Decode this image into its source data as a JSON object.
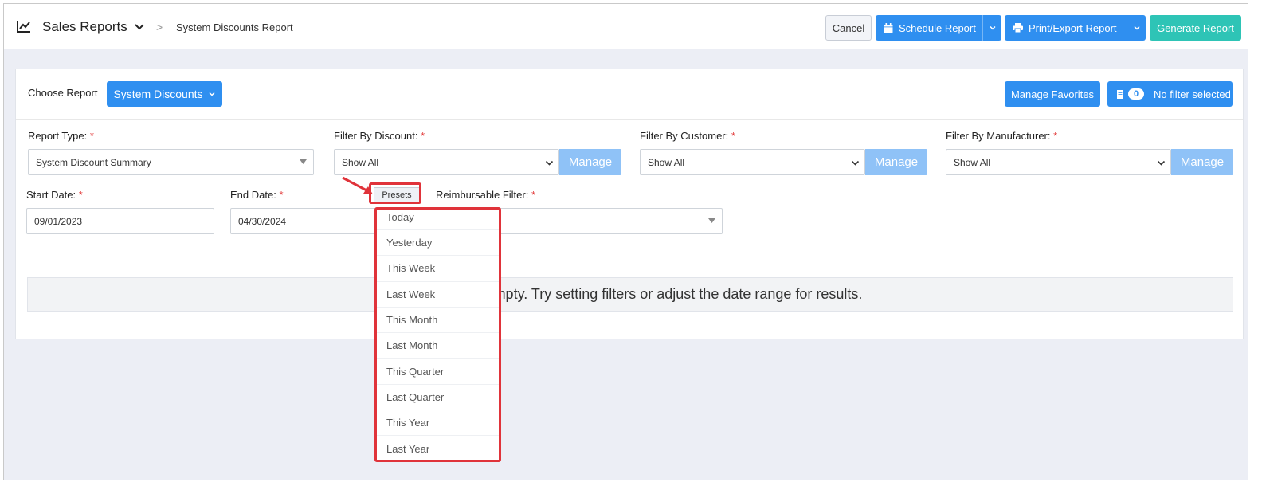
{
  "header": {
    "title": "Sales Reports",
    "separator": ">",
    "breadcrumb": "System Discounts Report",
    "cancel_label": "Cancel",
    "schedule_label": "Schedule Report",
    "print_label": "Print/Export Report",
    "generate_label": "Generate Report"
  },
  "toolbar": {
    "choose_label": "Choose Report",
    "report_button": "System Discounts",
    "manage_favorites": "Manage Favorites",
    "filter_count": "0",
    "no_filter": "No filter selected"
  },
  "filters": {
    "report_type": {
      "label": "Report Type:",
      "value": "System Discount Summary"
    },
    "discount": {
      "label": "Filter By Discount:",
      "value": "Show All",
      "manage": "Manage"
    },
    "customer": {
      "label": "Filter By Customer:",
      "value": "Show All",
      "manage": "Manage"
    },
    "manufacturer": {
      "label": "Filter By Manufacturer:",
      "value": "Show All",
      "manage": "Manage"
    },
    "start_date": {
      "label": "Start Date:",
      "value": "09/01/2023"
    },
    "end_date": {
      "label": "End Date:",
      "value": "04/30/2024"
    },
    "presets_label": "Presets",
    "reimbursable": {
      "label": "Reimbursable Filter:",
      "value": ""
    },
    "required_mark": "*"
  },
  "empty_message": "mpty. Try setting filters or adjust the date range for results.",
  "presets_menu": [
    "Today",
    "Yesterday",
    "This Week",
    "Last Week",
    "This Month",
    "Last Month",
    "This Quarter",
    "Last Quarter",
    "This Year",
    "Last Year"
  ],
  "colors": {
    "primary": "#2f8ff0",
    "teal": "#2ec4b6",
    "manage": "#8fc2f7",
    "highlight": "#e0333a"
  }
}
